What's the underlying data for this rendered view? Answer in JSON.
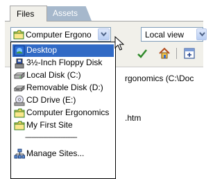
{
  "tabs": [
    {
      "label": "Files",
      "active": true
    },
    {
      "label": "Assets",
      "active": false
    }
  ],
  "site_select": {
    "value": "Computer Ergono",
    "icon": "folder-icon"
  },
  "view_select": {
    "value": "Local view"
  },
  "toolbar": {
    "icons": [
      "check-in-icon",
      "home-icon",
      "expand-icon"
    ]
  },
  "tree": {
    "line1": "rgonomics (C:\\Doc",
    "line2": ".htm"
  },
  "dropdown": {
    "items": [
      {
        "label": "Desktop",
        "icon": "desktop-icon",
        "selected": true
      },
      {
        "label": "3½-Inch Floppy Disk",
        "icon": "floppy-icon",
        "selected": false
      },
      {
        "label": "Local Disk (C:)",
        "icon": "hard-disk-icon",
        "selected": false
      },
      {
        "label": "Removable Disk (D:)",
        "icon": "removable-disk-icon",
        "selected": false
      },
      {
        "label": "CD Drive (E:)",
        "icon": "cd-drive-icon",
        "selected": false
      },
      {
        "label": "Computer Ergonomics",
        "icon": "folder-icon",
        "selected": false
      },
      {
        "label": "My First Site",
        "icon": "folder-icon",
        "selected": false
      }
    ],
    "divider": "--------------------------------",
    "manage": {
      "label": "Manage Sites...",
      "icon": "sites-icon"
    }
  },
  "colors": {
    "selection": "#316ac5",
    "panel": "#f1f0ea",
    "assets_tab": "#a6b8cc"
  }
}
